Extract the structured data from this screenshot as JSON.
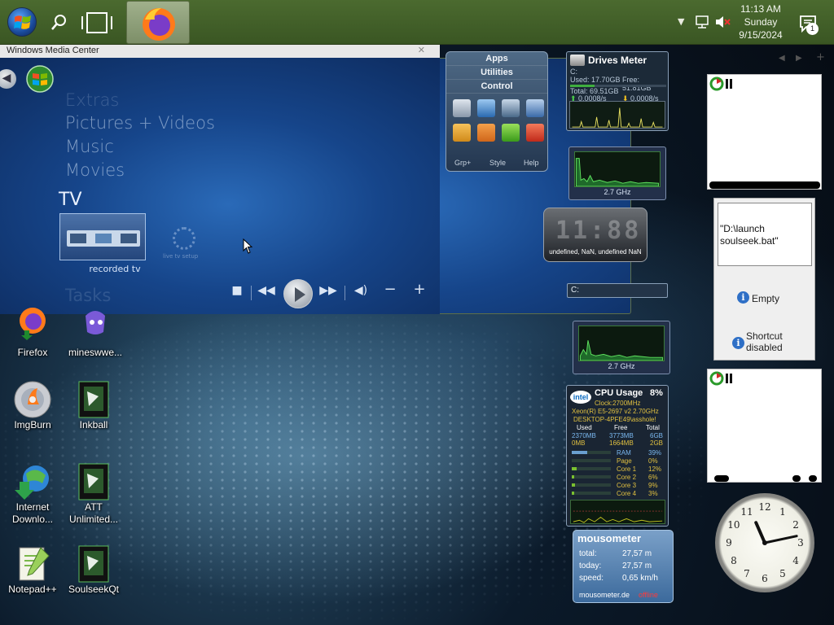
{
  "taskbar": {
    "clock_time": "11:13 AM",
    "clock_day": "Sunday",
    "clock_date": "9/15/2024",
    "notification_count": "1",
    "apps": [
      "firefox",
      "windows-media-center"
    ]
  },
  "media_center": {
    "window_title": "Windows Media Center",
    "menu": [
      "Extras",
      "Pictures + Videos",
      "Music",
      "Movies"
    ],
    "section": "TV",
    "tile_label": "recorded tv",
    "gear_label": "live tv setup",
    "next_section": "Tasks"
  },
  "desktop_icons": [
    {
      "label": "Firefox"
    },
    {
      "label": "mineswwe..."
    },
    {
      "label": "ImgBurn"
    },
    {
      "label": "Inkball"
    },
    {
      "label": "Internet Downlo..."
    },
    {
      "label": "ATT Unlimited..."
    },
    {
      "label": "Notepad++"
    },
    {
      "label": "SoulseekQt"
    }
  ],
  "launcher": {
    "categories": [
      "Apps",
      "Utilities",
      "Control"
    ],
    "footer": [
      "Grp+",
      "Style",
      "Help"
    ]
  },
  "drives_meter": {
    "title": "Drives Meter",
    "drive": "C:",
    "used": "Used: 17.70GB",
    "free": "Free: 51.81GB",
    "total": "Total: 69.51GB",
    "read": "0.0008/s",
    "write": "0.0008/s",
    "used_fraction": 0.25
  },
  "cpu_meters": [
    {
      "ghz": "2.7 GHz"
    },
    {
      "ghz": "2.7 GHz"
    }
  ],
  "digital_clock": {
    "digits": "11:88",
    "date": "undefined, NaN, undefined NaN"
  },
  "drive_input": {
    "value": "C:"
  },
  "cpu_usage": {
    "title": "CPU Usage",
    "percent": "8%",
    "brand": "intel",
    "clock": "Clock:2700MHz",
    "cpu_name": "Xeon(R) E5-2697 v2 2.70GHz",
    "host": "DESKTOP-4PFE49\\asshole!",
    "columns": [
      "Used",
      "Free",
      "Total"
    ],
    "mem_rows": [
      [
        "2370MB",
        "3773MB",
        "6GB"
      ],
      [
        "0MB",
        "1664MB",
        "2GB"
      ]
    ],
    "bars": [
      {
        "label": "RAM",
        "value": "39%",
        "fraction": 0.39
      },
      {
        "label": "Page",
        "value": "0%",
        "fraction": 0.0
      },
      {
        "label": "Core 1",
        "value": "12%",
        "fraction": 0.12
      },
      {
        "label": "Core 2",
        "value": "6%",
        "fraction": 0.06
      },
      {
        "label": "Core 3",
        "value": "9%",
        "fraction": 0.09
      },
      {
        "label": "Core 4",
        "value": "3%",
        "fraction": 0.03
      }
    ]
  },
  "mousometer": {
    "title": "mousometer",
    "total_label": "total:",
    "total_value": "27,57 m",
    "today_label": "today:",
    "today_value": "27,57 m",
    "speed_label": "speed:",
    "speed_value": "0,65 km/h",
    "site": "mousometer.de",
    "status": "offline"
  },
  "launch_gadget": {
    "path": "\"D:\\launch soulseek.bat\"",
    "empty": "Empty",
    "shortcut": "Shortcut disabled"
  },
  "analog_clock": {
    "numbers": [
      "12",
      "1",
      "2",
      "3",
      "4",
      "5",
      "6",
      "7",
      "8",
      "9",
      "10",
      "11"
    ],
    "hour": 11,
    "minute": 13
  }
}
